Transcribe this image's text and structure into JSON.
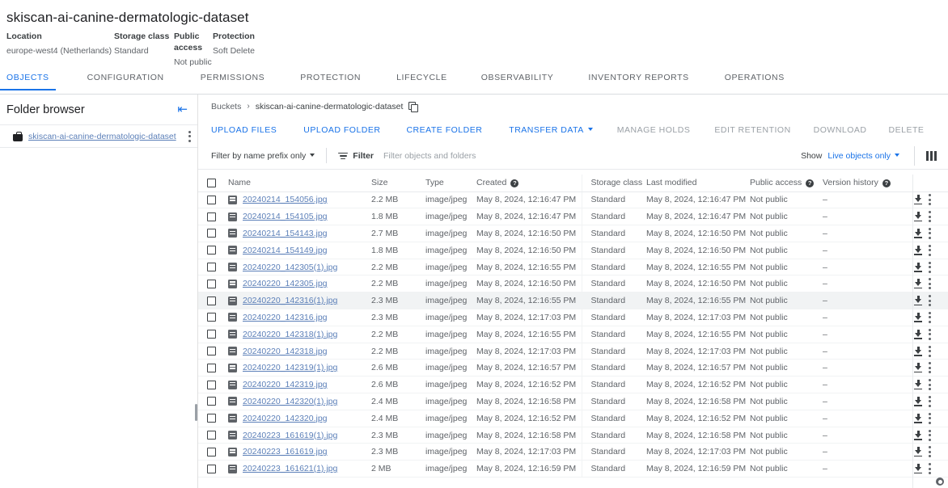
{
  "bucket": {
    "title": "skiscan-ai-canine-dermatologic-dataset",
    "meta": [
      {
        "label": "Location",
        "value": "europe-west4 (Netherlands)"
      },
      {
        "label": "Storage class",
        "value": "Standard"
      },
      {
        "label": "Public access",
        "value": "Not public"
      },
      {
        "label": "Protection",
        "value": "Soft Delete"
      }
    ]
  },
  "tabs": [
    {
      "label": "OBJECTS",
      "active": true
    },
    {
      "label": "CONFIGURATION",
      "active": false
    },
    {
      "label": "PERMISSIONS",
      "active": false
    },
    {
      "label": "PROTECTION",
      "active": false
    },
    {
      "label": "LIFECYCLE",
      "active": false
    },
    {
      "label": "OBSERVABILITY",
      "active": false
    },
    {
      "label": "INVENTORY REPORTS",
      "active": false
    },
    {
      "label": "OPERATIONS",
      "active": false
    }
  ],
  "folder_browser": {
    "title": "Folder browser",
    "collapse_icon": "collapse-left-icon",
    "bucket_item": "skiscan-ai-canine-dermatologic-dataset",
    "overflow_icon": "more-vert-icon"
  },
  "breadcrumb": {
    "root": "Buckets",
    "separator": "›",
    "current": "skiscan-ai-canine-dermatologic-dataset",
    "copy_icon": "copy-icon"
  },
  "actions": [
    {
      "label": "UPLOAD FILES",
      "disabled": false,
      "caret": false
    },
    {
      "label": "UPLOAD FOLDER",
      "disabled": false,
      "caret": false
    },
    {
      "label": "CREATE FOLDER",
      "disabled": false,
      "caret": false
    },
    {
      "label": "TRANSFER DATA",
      "disabled": false,
      "caret": true
    },
    {
      "label": "MANAGE HOLDS",
      "disabled": true,
      "caret": false
    },
    {
      "label": "EDIT RETENTION",
      "disabled": true,
      "caret": false
    },
    {
      "label": "DOWNLOAD",
      "disabled": true,
      "caret": false
    },
    {
      "label": "DELETE",
      "disabled": true,
      "caret": false
    }
  ],
  "filter_bar": {
    "prefix_label": "Filter by name prefix only",
    "filter_label": "Filter",
    "filter_placeholder": "Filter objects and folders",
    "show_label": "Show",
    "show_value": "Live objects only",
    "columns_icon": "columns-icon",
    "filter_icon": "filter-icon"
  },
  "table": {
    "columns": [
      {
        "key": "check",
        "label": ""
      },
      {
        "key": "name",
        "label": "Name",
        "help": false
      },
      {
        "key": "size",
        "label": "Size",
        "help": false
      },
      {
        "key": "type",
        "label": "Type",
        "help": false
      },
      {
        "key": "created",
        "label": "Created",
        "help": true
      },
      {
        "key": "storage_class",
        "label": "Storage class",
        "help": false
      },
      {
        "key": "last_modified",
        "label": "Last modified",
        "help": false
      },
      {
        "key": "public_access",
        "label": "Public access",
        "help": true
      },
      {
        "key": "version_history",
        "label": "Version history",
        "help": true
      }
    ],
    "rows": [
      {
        "name": "20240214_154056.jpg",
        "size": "2.2 MB",
        "type": "image/jpeg",
        "created": "May 8, 2024, 12:16:47 PM",
        "storage_class": "Standard",
        "last_modified": "May 8, 2024, 12:16:47 PM",
        "public_access": "Not public",
        "version_history": "–",
        "highlight": false
      },
      {
        "name": "20240214_154105.jpg",
        "size": "1.8 MB",
        "type": "image/jpeg",
        "created": "May 8, 2024, 12:16:47 PM",
        "storage_class": "Standard",
        "last_modified": "May 8, 2024, 12:16:47 PM",
        "public_access": "Not public",
        "version_history": "–",
        "highlight": false
      },
      {
        "name": "20240214_154143.jpg",
        "size": "2.7 MB",
        "type": "image/jpeg",
        "created": "May 8, 2024, 12:16:50 PM",
        "storage_class": "Standard",
        "last_modified": "May 8, 2024, 12:16:50 PM",
        "public_access": "Not public",
        "version_history": "–",
        "highlight": false
      },
      {
        "name": "20240214_154149.jpg",
        "size": "1.8 MB",
        "type": "image/jpeg",
        "created": "May 8, 2024, 12:16:50 PM",
        "storage_class": "Standard",
        "last_modified": "May 8, 2024, 12:16:50 PM",
        "public_access": "Not public",
        "version_history": "–",
        "highlight": false
      },
      {
        "name": "20240220_142305(1).jpg",
        "size": "2.2 MB",
        "type": "image/jpeg",
        "created": "May 8, 2024, 12:16:55 PM",
        "storage_class": "Standard",
        "last_modified": "May 8, 2024, 12:16:55 PM",
        "public_access": "Not public",
        "version_history": "–",
        "highlight": false
      },
      {
        "name": "20240220_142305.jpg",
        "size": "2.2 MB",
        "type": "image/jpeg",
        "created": "May 8, 2024, 12:16:50 PM",
        "storage_class": "Standard",
        "last_modified": "May 8, 2024, 12:16:50 PM",
        "public_access": "Not public",
        "version_history": "–",
        "highlight": false
      },
      {
        "name": "20240220_142316(1).jpg",
        "size": "2.3 MB",
        "type": "image/jpeg",
        "created": "May 8, 2024, 12:16:55 PM",
        "storage_class": "Standard",
        "last_modified": "May 8, 2024, 12:16:55 PM",
        "public_access": "Not public",
        "version_history": "–",
        "highlight": true
      },
      {
        "name": "20240220_142316.jpg",
        "size": "2.3 MB",
        "type": "image/jpeg",
        "created": "May 8, 2024, 12:17:03 PM",
        "storage_class": "Standard",
        "last_modified": "May 8, 2024, 12:17:03 PM",
        "public_access": "Not public",
        "version_history": "–",
        "highlight": false
      },
      {
        "name": "20240220_142318(1).jpg",
        "size": "2.2 MB",
        "type": "image/jpeg",
        "created": "May 8, 2024, 12:16:55 PM",
        "storage_class": "Standard",
        "last_modified": "May 8, 2024, 12:16:55 PM",
        "public_access": "Not public",
        "version_history": "–",
        "highlight": false
      },
      {
        "name": "20240220_142318.jpg",
        "size": "2.2 MB",
        "type": "image/jpeg",
        "created": "May 8, 2024, 12:17:03 PM",
        "storage_class": "Standard",
        "last_modified": "May 8, 2024, 12:17:03 PM",
        "public_access": "Not public",
        "version_history": "–",
        "highlight": false
      },
      {
        "name": "20240220_142319(1).jpg",
        "size": "2.6 MB",
        "type": "image/jpeg",
        "created": "May 8, 2024, 12:16:57 PM",
        "storage_class": "Standard",
        "last_modified": "May 8, 2024, 12:16:57 PM",
        "public_access": "Not public",
        "version_history": "–",
        "highlight": false
      },
      {
        "name": "20240220_142319.jpg",
        "size": "2.6 MB",
        "type": "image/jpeg",
        "created": "May 8, 2024, 12:16:52 PM",
        "storage_class": "Standard",
        "last_modified": "May 8, 2024, 12:16:52 PM",
        "public_access": "Not public",
        "version_history": "–",
        "highlight": false
      },
      {
        "name": "20240220_142320(1).jpg",
        "size": "2.4 MB",
        "type": "image/jpeg",
        "created": "May 8, 2024, 12:16:58 PM",
        "storage_class": "Standard",
        "last_modified": "May 8, 2024, 12:16:58 PM",
        "public_access": "Not public",
        "version_history": "–",
        "highlight": false
      },
      {
        "name": "20240220_142320.jpg",
        "size": "2.4 MB",
        "type": "image/jpeg",
        "created": "May 8, 2024, 12:16:52 PM",
        "storage_class": "Standard",
        "last_modified": "May 8, 2024, 12:16:52 PM",
        "public_access": "Not public",
        "version_history": "–",
        "highlight": false
      },
      {
        "name": "20240223_161619(1).jpg",
        "size": "2.3 MB",
        "type": "image/jpeg",
        "created": "May 8, 2024, 12:16:58 PM",
        "storage_class": "Standard",
        "last_modified": "May 8, 2024, 12:16:58 PM",
        "public_access": "Not public",
        "version_history": "–",
        "highlight": false
      },
      {
        "name": "20240223_161619.jpg",
        "size": "2.3 MB",
        "type": "image/jpeg",
        "created": "May 8, 2024, 12:17:03 PM",
        "storage_class": "Standard",
        "last_modified": "May 8, 2024, 12:17:03 PM",
        "public_access": "Not public",
        "version_history": "–",
        "highlight": false
      },
      {
        "name": "20240223_161621(1).jpg",
        "size": "2 MB",
        "type": "image/jpeg",
        "created": "May 8, 2024, 12:16:59 PM",
        "storage_class": "Standard",
        "last_modified": "May 8, 2024, 12:16:59 PM",
        "public_access": "Not public",
        "version_history": "–",
        "highlight": false
      }
    ],
    "row_icons": {
      "download": "download-icon",
      "more": "more-vert-icon",
      "file": "file-icon"
    }
  },
  "colors": {
    "accent": "#1a73e8",
    "link": "#5b7fb8",
    "text_primary": "#202124",
    "text_secondary": "#5f6368",
    "disabled": "#9aa0a6",
    "divider": "#e8eaed",
    "row_highlight": "#f1f3f4"
  }
}
